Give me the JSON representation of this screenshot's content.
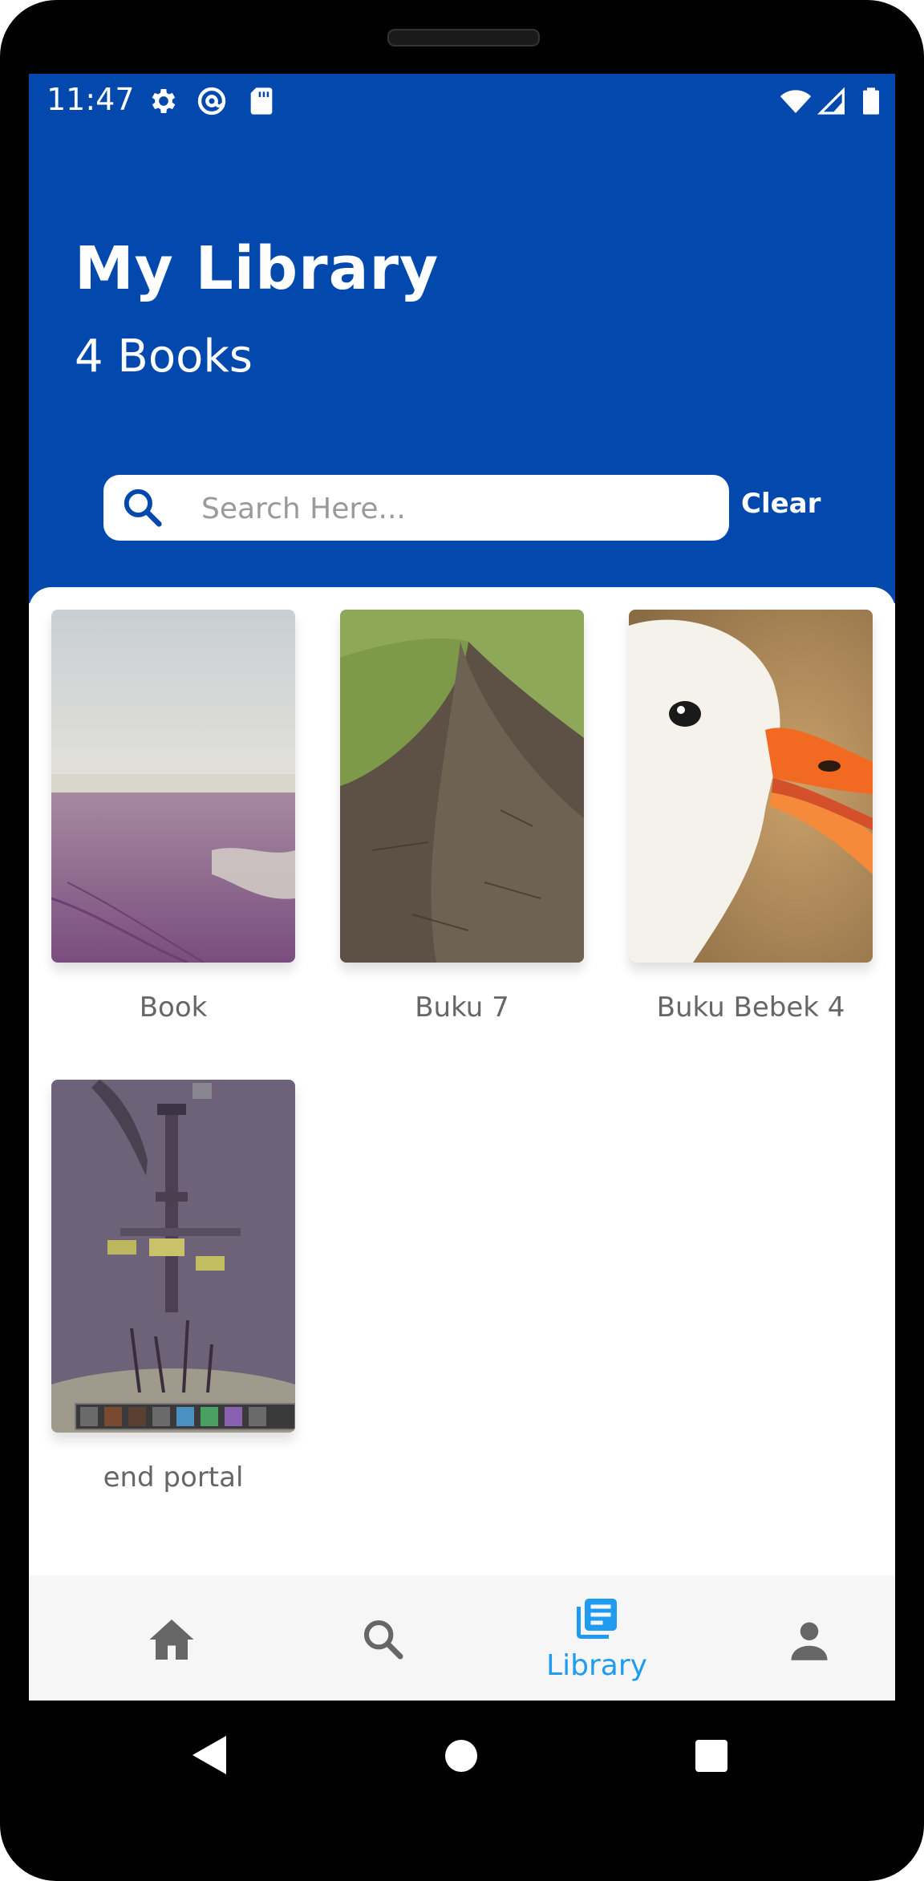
{
  "status_bar": {
    "time": "11:47",
    "left_icons": [
      "gear-icon",
      "at-sign-icon",
      "sd-card-icon"
    ],
    "right_icons": [
      "wifi-icon",
      "signal-icon",
      "battery-icon"
    ]
  },
  "header": {
    "title": "My Library",
    "subtitle": "4 Books"
  },
  "search": {
    "placeholder": "Search Here...",
    "value": "",
    "clear_label": "Clear"
  },
  "books": [
    {
      "title": "Book"
    },
    {
      "title": "Buku 7"
    },
    {
      "title": "Buku Bebek 4"
    },
    {
      "title": "end portal"
    }
  ],
  "bottom_nav": {
    "items": [
      {
        "icon": "home-icon",
        "label": ""
      },
      {
        "icon": "search-icon",
        "label": ""
      },
      {
        "icon": "library-icon",
        "label": "Library",
        "active": true
      },
      {
        "icon": "person-icon",
        "label": ""
      }
    ],
    "active_color": "#1F9CF0",
    "inactive_color": "#666666"
  },
  "colors": {
    "header_bg": "#0349AD",
    "accent": "#1F9CF0"
  }
}
